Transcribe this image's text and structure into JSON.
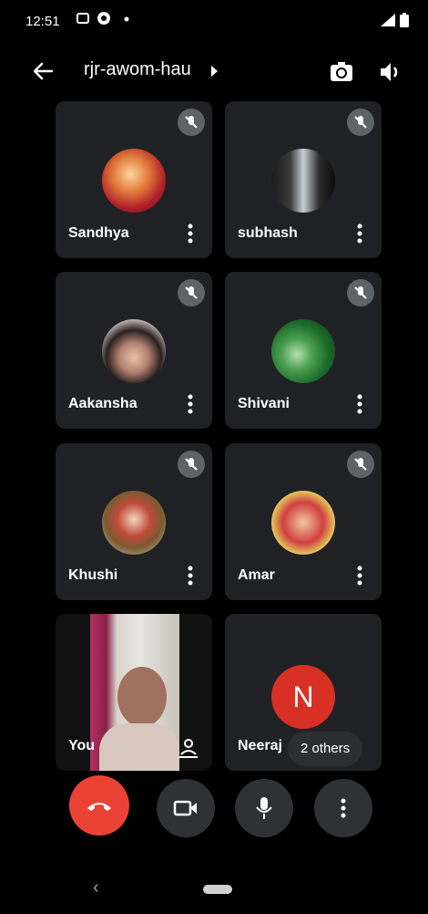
{
  "status_bar": {
    "time": "12:51"
  },
  "header": {
    "meeting_code": "rjr-awom-hau"
  },
  "participants": [
    {
      "name": "Sandhya"
    },
    {
      "name": "subhash"
    },
    {
      "name": "Aakansha"
    },
    {
      "name": "Shivani"
    },
    {
      "name": "Khushi"
    },
    {
      "name": "Amar"
    }
  ],
  "self_tile": {
    "name": "You"
  },
  "neeraj_tile": {
    "name": "Neeraj",
    "initial": "N",
    "others_label": "2 others"
  },
  "colors": {
    "end_call": "#ea4335",
    "tile_bg": "#202124",
    "avatar_n": "#d93025"
  },
  "controls": {
    "end_call": "end-call-icon",
    "camera": "video-icon",
    "mic": "mic-icon",
    "more": "more-vert-icon"
  }
}
